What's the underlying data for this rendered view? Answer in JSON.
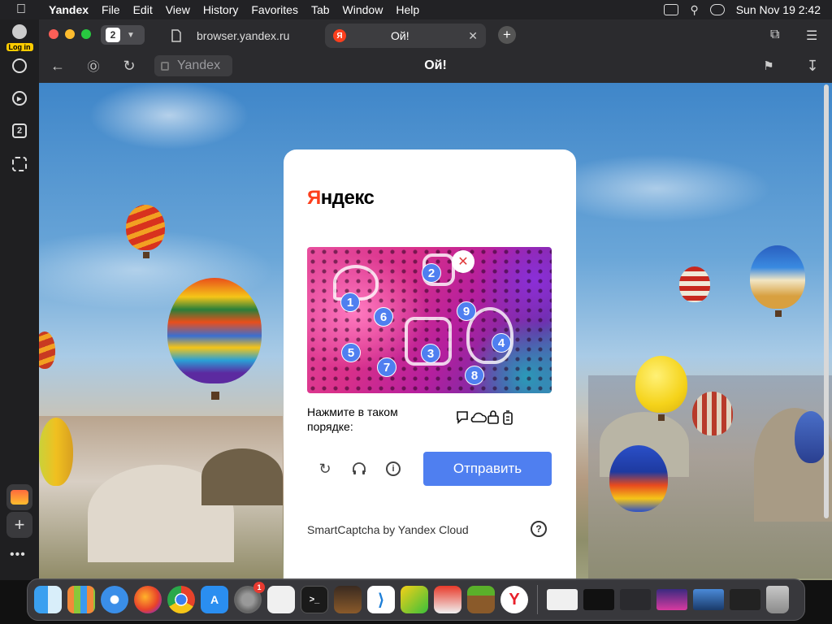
{
  "menubar": {
    "app_name": "Yandex",
    "menus": [
      "File",
      "Edit",
      "View",
      "History",
      "Favorites",
      "Tab",
      "Window",
      "Help"
    ],
    "clock": "Sun Nov 19  2:42"
  },
  "tabs": {
    "count": "2",
    "inactive_title": "browser.yandex.ru",
    "active_title": "Ой!",
    "active_favicon": "Я"
  },
  "address": {
    "url_text": "Yandex",
    "page_title": "Ой!"
  },
  "sidebar": {
    "login_label": "Log in",
    "items": [
      "history-icon",
      "play-icon",
      "tab-count-icon",
      "screenshot-icon"
    ],
    "tab_count": "2"
  },
  "captcha": {
    "logo": "Яндекс",
    "markers": [
      "1",
      "2",
      "3",
      "4",
      "5",
      "6",
      "7",
      "8",
      "9"
    ],
    "instruction": "Нажмите в таком порядке:",
    "sequence_icons": [
      "speech-bubble-icon",
      "cloud-icon",
      "padlock-icon",
      "battery-icon"
    ],
    "submit_label": "Отправить",
    "footer": "SmartCaptcha by Yandex Cloud",
    "help": "?"
  },
  "dock": {
    "apps": [
      "Finder",
      "Launchpad",
      "Safari",
      "Firefox",
      "Chrome",
      "App Store",
      "System Settings",
      "TextEdit",
      "Terminal",
      "GarageBand",
      "VS Code",
      "Game",
      "Package",
      "Minecraft",
      "Yandex"
    ],
    "system_settings_badge": "1"
  },
  "colors": {
    "yandex_red": "#fc3f1d",
    "accent_blue": "#4f7ff0"
  }
}
